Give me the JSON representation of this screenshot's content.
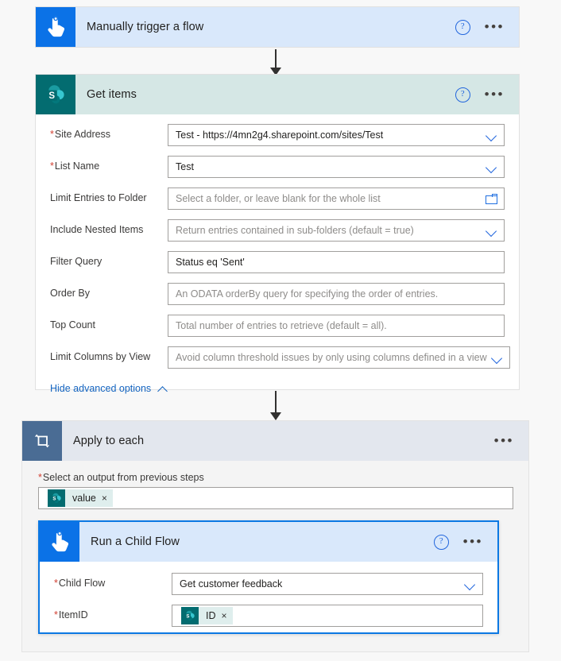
{
  "trigger": {
    "title": "Manually trigger a flow",
    "icon": "tap-hand-icon",
    "help_label": "?",
    "menu_label": "•••"
  },
  "get_items": {
    "title": "Get items",
    "icon": "sharepoint-icon",
    "help_label": "?",
    "menu_label": "•••",
    "advanced_link": "Hide advanced options",
    "fields": [
      {
        "label": "Site Address",
        "required": true,
        "value": "Test - https://4mn2g4.sharepoint.com/sites/Test",
        "placeholder": "",
        "control": "dropdown"
      },
      {
        "label": "List Name",
        "required": true,
        "value": "Test",
        "placeholder": "",
        "control": "dropdown"
      },
      {
        "label": "Limit Entries to Folder",
        "required": false,
        "value": "",
        "placeholder": "Select a folder, or leave blank for the whole list",
        "control": "folder"
      },
      {
        "label": "Include Nested Items",
        "required": false,
        "value": "",
        "placeholder": "Return entries contained in sub-folders (default = true)",
        "control": "dropdown"
      },
      {
        "label": "Filter Query",
        "required": false,
        "value": "Status eq 'Sent'",
        "placeholder": "",
        "control": "text"
      },
      {
        "label": "Order By",
        "required": false,
        "value": "",
        "placeholder": "An ODATA orderBy query for specifying the order of entries.",
        "control": "text"
      },
      {
        "label": "Top Count",
        "required": false,
        "value": "",
        "placeholder": "Total number of entries to retrieve (default = all).",
        "control": "text"
      },
      {
        "label": "Limit Columns by View",
        "required": false,
        "value": "",
        "placeholder": "Avoid column threshold issues by only using columns defined in a view",
        "control": "dropdown"
      }
    ]
  },
  "apply_to_each": {
    "title": "Apply to each",
    "icon": "loop-icon",
    "menu_label": "•••",
    "output_label": "Select an output from previous steps",
    "output_required": true,
    "token": {
      "label": "value",
      "icon": "sharepoint-icon",
      "remove_label": "×"
    }
  },
  "child_flow": {
    "title": "Run a Child Flow",
    "icon": "tap-hand-icon",
    "help_label": "?",
    "menu_label": "•••",
    "fields": [
      {
        "label": "Child Flow",
        "required": true,
        "value": "Get customer feedback",
        "placeholder": "",
        "control": "dropdown"
      }
    ],
    "item_id": {
      "label": "ItemID",
      "required": true,
      "token": {
        "label": "ID",
        "icon": "sharepoint-icon",
        "remove_label": "×"
      }
    }
  },
  "colors": {
    "trigger_blue": "#0b72e7",
    "trigger_header": "#d9e8fb",
    "sharepoint_teal": "#036c70",
    "sharepoint_header": "#d5e7e5",
    "loop_slate": "#4a6c94",
    "loop_header": "#e3e7ee",
    "selected_border": "#0b78e3",
    "link_blue": "#1464c0",
    "required_red": "#d23f31",
    "canvas": "#f8f8f8"
  }
}
